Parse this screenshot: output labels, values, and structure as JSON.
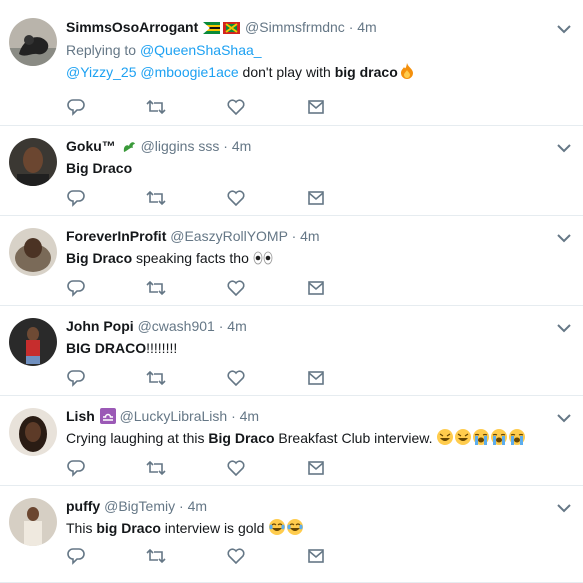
{
  "tweets": [
    {
      "name": "SimmsOsoArrogant",
      "handle": "@Simmsfrmdnc",
      "time": "4m",
      "replying_label": "Replying to",
      "replying_to": "@QueenShaShaa_",
      "text_parts": [
        "@Yizzy_25",
        " ",
        "@mboogie1ace",
        " don't play with ",
        "big draco"
      ],
      "emoji": [
        "fire"
      ]
    },
    {
      "name": "Goku™",
      "handle": "@liggins sss",
      "time": "4m",
      "text_parts": [
        "Big Draco"
      ]
    },
    {
      "name": "ForeverInProfit",
      "handle": "@EaszyRollYOMP",
      "time": "4m",
      "text_parts": [
        "Big Draco",
        " speaking facts tho "
      ],
      "emoji": [
        "eyes"
      ]
    },
    {
      "name": "John Popi",
      "handle": "@cwash901",
      "time": "4m",
      "text_parts": [
        "BIG DRACO",
        "!!!!!!!!"
      ]
    },
    {
      "name": "Lish",
      "handle": "@LuckyLibraLish",
      "time": "4m",
      "text_parts": [
        "Crying laughing at this ",
        "Big Draco",
        " Breakfast Club interview. "
      ],
      "emoji": [
        "rofl",
        "rofl",
        "sob",
        "sob",
        "sob"
      ]
    },
    {
      "name": "puffy",
      "handle": "@BigTemiy",
      "time": "4m",
      "text_parts": [
        "This ",
        "big Draco",
        " interview is gold "
      ],
      "emoji": [
        "joy",
        "joy"
      ]
    }
  ],
  "icons": {
    "reply": "reply-icon",
    "retweet": "retweet-icon",
    "like": "heart-icon",
    "dm": "envelope-icon",
    "caret": "chevron-down-icon"
  },
  "colors": {
    "text": "#14171a",
    "secondary": "#657786",
    "link": "#1da1f2",
    "divider": "#e6ecf0"
  }
}
